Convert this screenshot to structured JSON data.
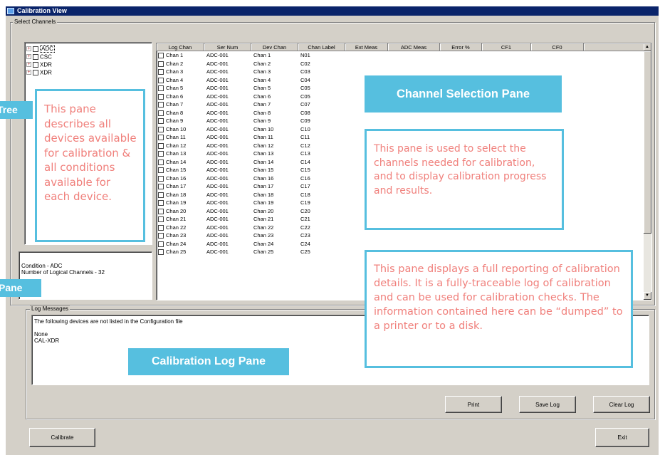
{
  "window": {
    "title": "Calibration View"
  },
  "channels_group": {
    "label": "Select Channels"
  },
  "tree": {
    "items": [
      {
        "label": "ADC",
        "selected": true
      },
      {
        "label": "CSC",
        "selected": false
      },
      {
        "label": "XDR",
        "selected": false
      },
      {
        "label": "XDR",
        "selected": false
      }
    ]
  },
  "info": {
    "line1": "Condition - ADC",
    "line2": "Number of Logical Channels - 32"
  },
  "table": {
    "columns": [
      "Log Chan",
      "Ser Num",
      "Dev Chan",
      "Chan Label",
      "Ext Meas",
      "ADC Meas",
      "Error %",
      "CF1",
      "CF0"
    ],
    "rows": [
      [
        "Chan 1",
        "ADC-001",
        "Chan 1",
        "N01"
      ],
      [
        "Chan 2",
        "ADC-001",
        "Chan 2",
        "C02"
      ],
      [
        "Chan 3",
        "ADC-001",
        "Chan 3",
        "C03"
      ],
      [
        "Chan 4",
        "ADC-001",
        "Chan 4",
        "C04"
      ],
      [
        "Chan 5",
        "ADC-001",
        "Chan 5",
        "C05"
      ],
      [
        "Chan 6",
        "ADC-001",
        "Chan 6",
        "C05"
      ],
      [
        "Chan 7",
        "ADC-001",
        "Chan 7",
        "C07"
      ],
      [
        "Chan 8",
        "ADC-001",
        "Chan 8",
        "C08"
      ],
      [
        "Chan 9",
        "ADC-001",
        "Chan 9",
        "C09"
      ],
      [
        "Chan 10",
        "ADC-001",
        "Chan 10",
        "C10"
      ],
      [
        "Chan 11",
        "ADC-001",
        "Chan 11",
        "C11"
      ],
      [
        "Chan 12",
        "ADC-001",
        "Chan 12",
        "C12"
      ],
      [
        "Chan 13",
        "ADC-001",
        "Chan 13",
        "C13"
      ],
      [
        "Chan 14",
        "ADC-001",
        "Chan 14",
        "C14"
      ],
      [
        "Chan 15",
        "ADC-001",
        "Chan 15",
        "C15"
      ],
      [
        "Chan 16",
        "ADC-001",
        "Chan 16",
        "C16"
      ],
      [
        "Chan 17",
        "ADC-001",
        "Chan 17",
        "C17"
      ],
      [
        "Chan 18",
        "ADC-001",
        "Chan 18",
        "C18"
      ],
      [
        "Chan 19",
        "ADC-001",
        "Chan 19",
        "C19"
      ],
      [
        "Chan 20",
        "ADC-001",
        "Chan 20",
        "C20"
      ],
      [
        "Chan 21",
        "ADC-001",
        "Chan 21",
        "C21"
      ],
      [
        "Chan 22",
        "ADC-001",
        "Chan 22",
        "C22"
      ],
      [
        "Chan 23",
        "ADC-001",
        "Chan 23",
        "C23"
      ],
      [
        "Chan 24",
        "ADC-001",
        "Chan 24",
        "C24"
      ],
      [
        "Chan 25",
        "ADC-001",
        "Chan 25",
        "C25"
      ]
    ]
  },
  "log": {
    "label": "Log Messages",
    "lines": [
      "The following devices are not listed in the Configuration file",
      "",
      "None",
      "CAL-XDR"
    ]
  },
  "buttons": {
    "print": "Print",
    "save_log": "Save Log",
    "clear_log": "Clear Log",
    "calibrate": "Calibrate",
    "exit": "Exit"
  },
  "annotations": {
    "tree_banner": "Tree",
    "tree_callout": "This pane describes all devices available for calibration & all conditions available for each device.",
    "info_banner": "Pane",
    "channel_banner": "Channel Selection Pane",
    "channel_callout": "This pane is used to select the channels needed for calibration, and to display calibration progress and results.",
    "log_callout": "This pane displays a full reporting of calibration details.  It is a fully-traceable log of calibration and can be used for calibration checks.  The information contained here can be “dumped” to a printer or to a disk.",
    "log_banner": "Calibration Log Pane"
  },
  "colors": {
    "title_bar": "#0a246a",
    "window_face": "#d4d0c8",
    "callout_border": "#56bfdf",
    "callout_text": "#f0807c",
    "banner_bg": "#56bfdf",
    "banner_text": "#ffffff"
  }
}
